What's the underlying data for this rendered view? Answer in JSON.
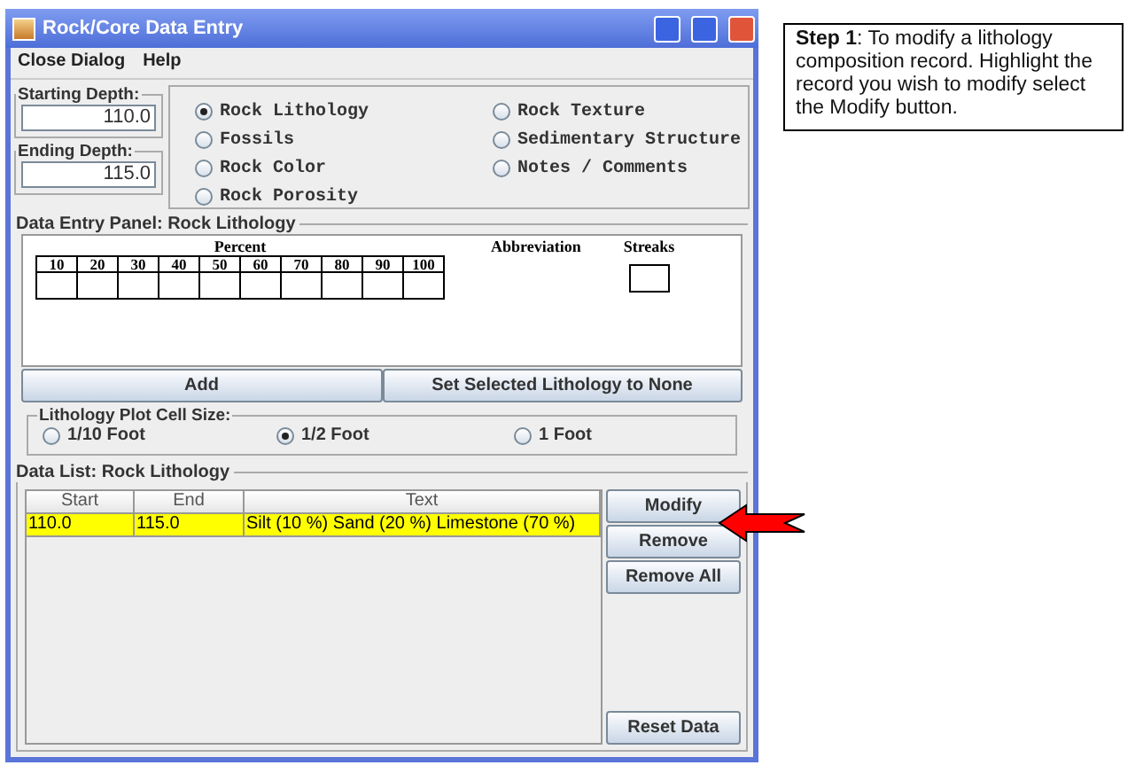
{
  "window": {
    "title": "Rock/Core Data Entry"
  },
  "menu": [
    "Close Dialog",
    "Help"
  ],
  "depths": [
    {
      "label": "Starting Depth:",
      "value": "110.0"
    },
    {
      "label": "Ending Depth:",
      "value": "115.0"
    }
  ],
  "categories": [
    {
      "label": "Rock Lithology",
      "selected": true
    },
    {
      "label": "Fossils",
      "selected": false
    },
    {
      "label": "Rock Color",
      "selected": false
    },
    {
      "label": "Rock Porosity",
      "selected": false
    },
    {
      "label": "Rock Texture",
      "selected": false
    },
    {
      "label": "Sedimentary Structure",
      "selected": false
    },
    {
      "label": "Notes / Comments",
      "selected": false
    }
  ],
  "entry_panel": {
    "title": "Data Entry Panel: Rock Lithology",
    "percent_label": "Percent",
    "percent_columns": [
      "10",
      "20",
      "30",
      "40",
      "50",
      "60",
      "70",
      "80",
      "90",
      "100"
    ],
    "abbreviation_label": "Abbreviation",
    "streaks_label": "Streaks",
    "buttons": [
      "Add",
      "Set Selected Lithology to None"
    ]
  },
  "cell_size": {
    "title": "Lithology Plot Cell Size:",
    "options": [
      {
        "label": "1/10 Foot",
        "selected": false
      },
      {
        "label": "1/2 Foot",
        "selected": true
      },
      {
        "label": "1 Foot",
        "selected": false
      }
    ]
  },
  "data_list": {
    "title": "Data List: Rock Lithology",
    "columns": [
      "Start",
      "End",
      "Text"
    ],
    "rows": [
      {
        "cells": [
          "110.0",
          "115.0",
          "Silt (10 %) Sand (20 %) Limestone (70 %)"
        ],
        "selected": true
      }
    ],
    "buttons": [
      "Modify",
      "Remove",
      "Remove All"
    ],
    "reset_button": "Reset Data"
  },
  "callout": {
    "text": "**Step 1**: To modify a lithology composition record.  Highlight the record you wish to modify select the Modify button."
  }
}
